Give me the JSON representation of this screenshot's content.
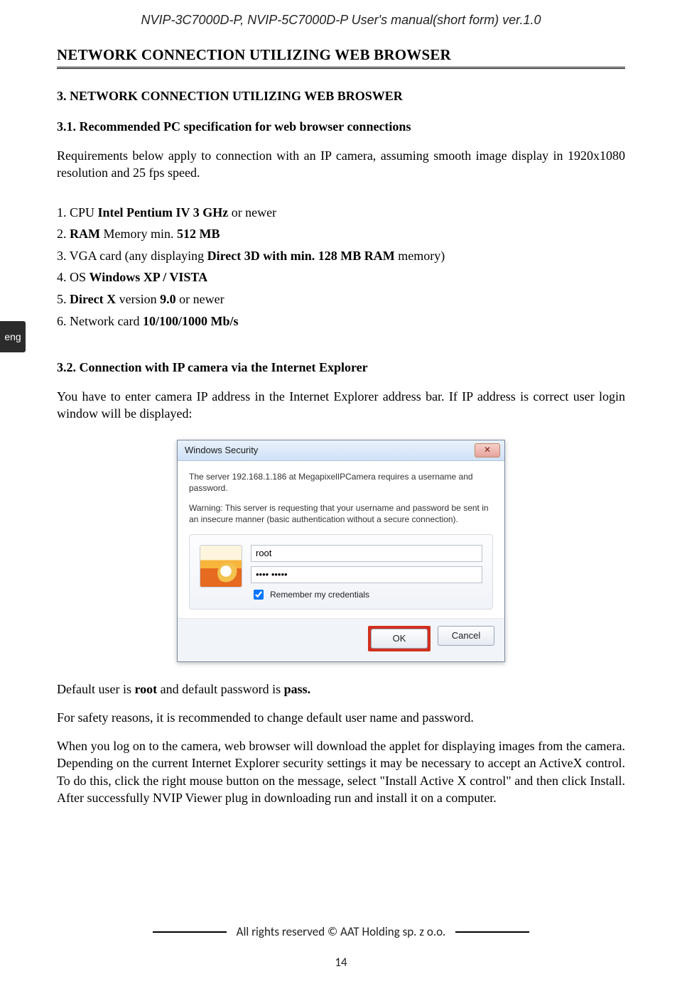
{
  "running_head": "NVIP-3C7000D-P, NVIP-5C7000D-P User's manual(short form) ver.1.0",
  "chapter_title": "NETWORK CONNECTION UTILIZING WEB BROWSER",
  "lang_tab": "eng",
  "section3": {
    "heading": "3. NETWORK CONNECTION UTILIZING WEB BROSWER",
    "sub31": "3.1. Recommended PC specification for web browser connections",
    "intro31": "Requirements below apply to connection with an IP camera, assuming smooth image display in 1920x1080 resolution and 25 fps speed.",
    "specs": [
      {
        "lead": "1. CPU ",
        "bold": "Intel Pentium IV 3 GHz",
        "tail": " or newer"
      },
      {
        "lead": "2. ",
        "bold": "RAM",
        "tail": " Memory min. ",
        "bold2": "512 MB"
      },
      {
        "lead": "3. VGA card (any displaying ",
        "bold": "Direct 3D with min. 128 MB RAM",
        "tail": " memory)"
      },
      {
        "lead": "4. OS ",
        "bold": "Windows XP / VISTA",
        "tail": ""
      },
      {
        "lead": "5. ",
        "bold": "Direct X",
        "tail": " version ",
        "bold2": "9.0",
        "tail2": " or newer"
      },
      {
        "lead": "6. Network card ",
        "bold": "10/100/1000 Mb/s",
        "tail": ""
      }
    ],
    "sub32": "3.2. Connection with IP camera via the Internet Explorer",
    "intro32": "You have to enter camera IP address in the Internet Explorer address bar. If IP address is correct user login window will be displayed:"
  },
  "dialog": {
    "title": "Windows Security",
    "close_symbol": "✕",
    "msg1": "The server 192.168.1.186 at MegapixelIPCamera requires a username and password.",
    "msg2": "Warning: This server is requesting that your username and password be sent in an insecure manner (basic authentication without a secure connection).",
    "username": "root",
    "password_display": "•••• •••••",
    "remember_label": "Remember my credentials",
    "ok": "OK",
    "cancel": "Cancel"
  },
  "after_dialog": {
    "p1_a": "Default user is ",
    "p1_b_bold": "root",
    "p1_c": " and default password is ",
    "p1_d_bold": "pass.",
    "p2": "For safety reasons, it is recommended to change default user name and password.",
    "p3": "When you log on to the camera, web browser will download the applet for displaying images from the camera. Depending on the current Internet Explorer security settings it may be necessary to accept an ActiveX control. To do this, click the right mouse button on the message, select \"Install Active X control\" and then click Install. After successfully NVIP Viewer plug in downloading run and install it on a computer."
  },
  "footer": {
    "rights": "All rights reserved © AAT Holding sp. z o.o.",
    "page_number": "14"
  }
}
